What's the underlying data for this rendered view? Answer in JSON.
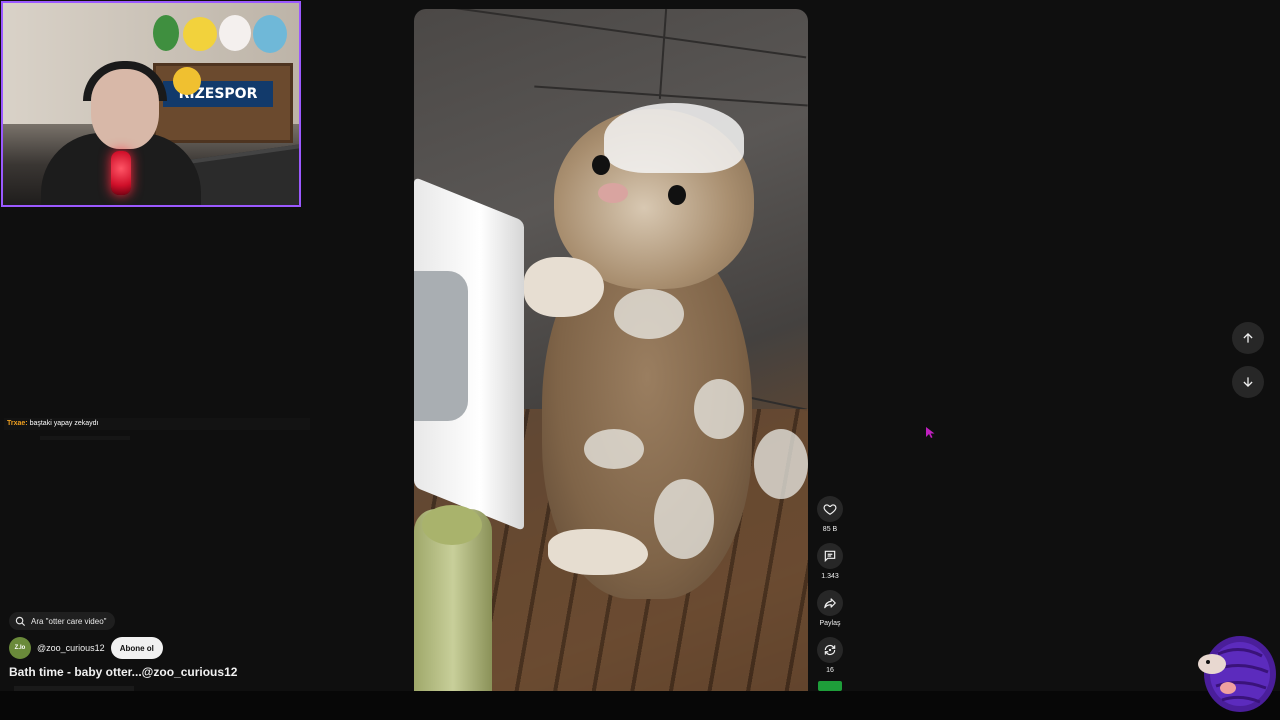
{
  "webcam": {
    "shelf_sign": "RİZESPOR",
    "border_color": "#9b59ff"
  },
  "chat": {
    "user": "Trxae:",
    "message": "baştaki yapay zekaydı"
  },
  "actions": {
    "like_count": "85 B",
    "comment_count": "1.343",
    "share_label": "Paylaş",
    "remix_count": "16"
  },
  "search": {
    "label": "Ara \"otter care video\""
  },
  "channel": {
    "avatar_text": "Z.Io",
    "handle": "@zoo_curious12",
    "subscribe_label": "Abone ol"
  },
  "video": {
    "title": "Bath time - baby otter...@zoo_curious12"
  },
  "icons": {
    "like": "heart-icon",
    "comment": "comment-icon",
    "share": "share-icon",
    "remix": "remix-icon",
    "search": "search-icon",
    "prev": "arrow-up-icon",
    "next": "arrow-down-icon"
  },
  "colors": {
    "background": "#0f0f0f",
    "button_bg": "#272727",
    "chat_user": "#f0a020",
    "accent_purple": "#9b59ff"
  }
}
